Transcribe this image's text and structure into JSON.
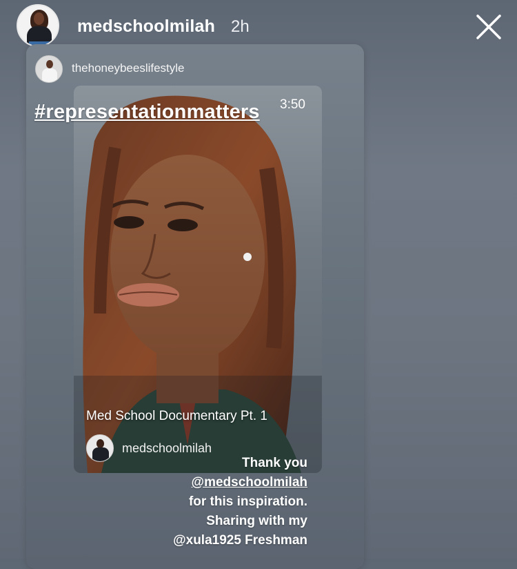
{
  "header": {
    "username": "medschoolmilah",
    "time": "2h"
  },
  "shared_story": {
    "source_username": "thehoneybeeslifestyle",
    "video": {
      "hashtag": "#representationmatters",
      "duration": "3:50",
      "title": "Med School Documentary Pt. 1",
      "creator_username": "medschoolmilah"
    },
    "caption": {
      "line1": "Thank you",
      "mention1": "@medschoolmilah",
      "line3": "for this inspiration.",
      "line4": "Sharing with my",
      "line5": "@xula1925 Freshman"
    }
  },
  "icons": {
    "close": "close-icon"
  }
}
